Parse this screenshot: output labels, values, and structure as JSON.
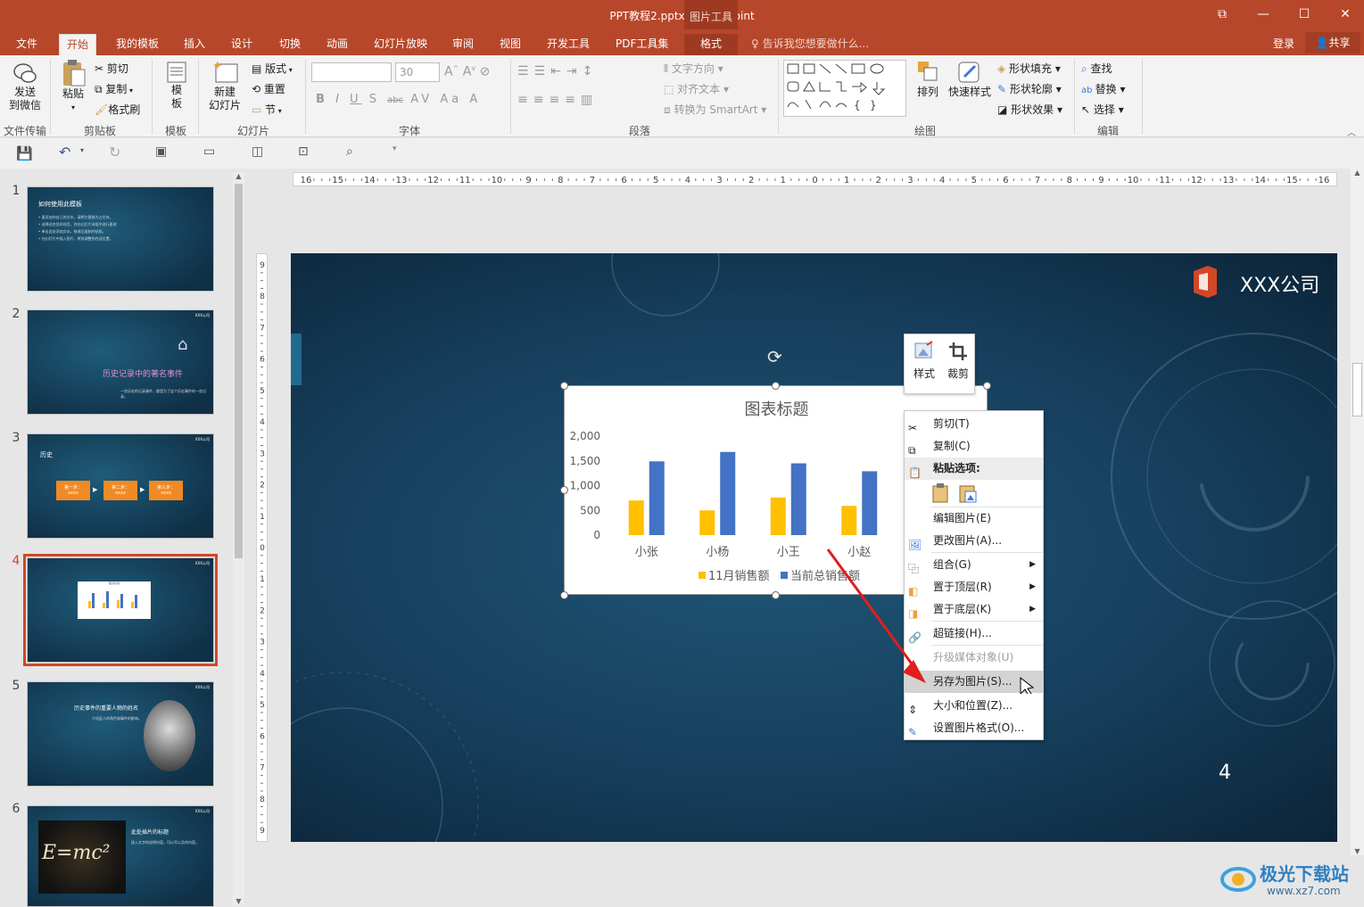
{
  "window": {
    "title": "PPT教程2.pptx - PowerPoint",
    "context_group": "图片工具",
    "buttons": [
      "⧉",
      "—",
      "☐",
      "✕"
    ]
  },
  "tabs": [
    "文件",
    "开始",
    "我的模板",
    "插入",
    "设计",
    "切换",
    "动画",
    "幻灯片放映",
    "审阅",
    "视图",
    "开发工具",
    "PDF工具集",
    "格式"
  ],
  "active_tab": "开始",
  "tell_me": "告诉我您想要做什么...",
  "account": {
    "login": "登录",
    "share": "共享"
  },
  "ribbon": {
    "file_transfer": {
      "btn": [
        "发送",
        "到微信"
      ],
      "label": "文件传输"
    },
    "clipboard": {
      "paste": "粘贴",
      "cut": "剪切",
      "copy": "复制",
      "format_painter": "格式刷",
      "label": "剪贴板"
    },
    "template": {
      "btn": [
        "模",
        "板"
      ],
      "label": "模板"
    },
    "slides": {
      "new_slide": [
        "新建",
        "幻灯片"
      ],
      "layout": "版式",
      "reset": "重置",
      "section": "节",
      "label": "幻灯片"
    },
    "font": {
      "size": "30",
      "label": "字体",
      "buttons": [
        "B",
        "I",
        "U",
        "S",
        "abc",
        "AV",
        "Aa",
        "A"
      ]
    },
    "paragraph": {
      "text_direction": "文字方向",
      "align_text": "对齐文本",
      "smartart": "转换为 SmartArt",
      "label": "段落"
    },
    "drawing": {
      "arrange": "排列",
      "quick_styles": "快速样式",
      "shape_fill": "形状填充",
      "shape_outline": "形状轮廓",
      "shape_effects": "形状效果",
      "label": "绘图"
    },
    "editing": {
      "find": "查找",
      "replace": "替换",
      "select": "选择",
      "label": "编辑"
    }
  },
  "ruler": {
    "h_labels": [
      "16",
      "15",
      "14",
      "13",
      "12",
      "11",
      "10",
      "9",
      "8",
      "7",
      "6",
      "5",
      "4",
      "3",
      "2",
      "1",
      "0",
      "1",
      "2",
      "3",
      "4",
      "5",
      "6",
      "7",
      "8",
      "9",
      "10",
      "11",
      "12",
      "13",
      "14",
      "15",
      "16"
    ],
    "v_labels": [
      "9",
      "8",
      "7",
      "6",
      "5",
      "4",
      "3",
      "2",
      "1",
      "0",
      "1",
      "2",
      "3",
      "4",
      "5",
      "6",
      "7",
      "8",
      "9"
    ]
  },
  "thumbnails": [
    {
      "num": "1",
      "title": "如何使用此模板",
      "lines": [
        "• 要添加你自己的文本，请将它替换为占位符。",
        "• 选择适合您的项目，并在幻灯片母版中进行更改",
        "• 单击此处添加文本，修改后复制并粘贴。",
        "• 在幻灯片中插入图片，将其调整到合适位置。"
      ]
    },
    {
      "num": "2",
      "title": "历史记录中的著名事件",
      "sub": "一些历史的记录事件，都是为了这个历史事件的一些记录。",
      "logo": "XXX公司"
    },
    {
      "num": "3",
      "title": "历史",
      "steps": [
        "第一步：",
        "第二步：",
        "第三步："
      ],
      "step_sub": "xxxx",
      "logo": "XXX公司"
    },
    {
      "num": "4",
      "title": "图表标题",
      "logo": "XXX公司"
    },
    {
      "num": "5",
      "title": "历史事件的重要人物的姓名",
      "sub": "介绍此人的角色和事件的影响。",
      "logo": "XXX公司"
    },
    {
      "num": "6",
      "title": "此处插片的标题",
      "sub": "插入文字的说明内容，可以写以及的内容。",
      "formula": "E=mc²",
      "logo": "XXX公司"
    }
  ],
  "slide": {
    "company": "XXX公司",
    "page_number": "4"
  },
  "chart_data": {
    "type": "bar",
    "title": "图表标题",
    "categories": [
      "小张",
      "小杨",
      "小王",
      "小赵"
    ],
    "series": [
      {
        "name": "11月销售额",
        "values": [
          700,
          500,
          760,
          590
        ],
        "color": "#ffc000"
      },
      {
        "name": "当前总销售额",
        "values": [
          1490,
          1680,
          1450,
          1290
        ],
        "color": "#4472c4"
      }
    ],
    "ylim": [
      0,
      2000
    ],
    "yticks": [
      "2,000",
      "1,500",
      "1,000",
      "500",
      "0"
    ],
    "legend": "bottom"
  },
  "mini_toolbar": {
    "style": "样式",
    "crop": "裁剪"
  },
  "context_menu": [
    {
      "label": "剪切(T)",
      "icon": "scissors-icon"
    },
    {
      "label": "复制(C)",
      "icon": "copy-icon"
    },
    {
      "label": "粘贴选项:",
      "icon": "paste-icon",
      "header": true
    },
    {
      "label": "",
      "icon": "paste-options-icon",
      "paste_row": true
    },
    {
      "label": "编辑图片(E)",
      "icon": ""
    },
    {
      "label": "更改图片(A)...",
      "icon": "change-picture-icon"
    },
    {
      "label": "组合(G)",
      "icon": "group-icon",
      "submenu": true
    },
    {
      "label": "置于顶层(R)",
      "icon": "bring-front-icon",
      "submenu": true
    },
    {
      "label": "置于底层(K)",
      "icon": "send-back-icon",
      "submenu": true
    },
    {
      "label": "超链接(H)...",
      "icon": "hyperlink-icon"
    },
    {
      "label": "升级媒体对象(U)",
      "icon": "",
      "disabled": true
    },
    {
      "label": "另存为图片(S)...",
      "icon": "",
      "highlight": true
    },
    {
      "label": "大小和位置(Z)...",
      "icon": "size-position-icon"
    },
    {
      "label": "设置图片格式(O)...",
      "icon": "format-picture-icon"
    }
  ],
  "watermark": {
    "brand": "极光下载站",
    "url": "www.xz7.com"
  }
}
